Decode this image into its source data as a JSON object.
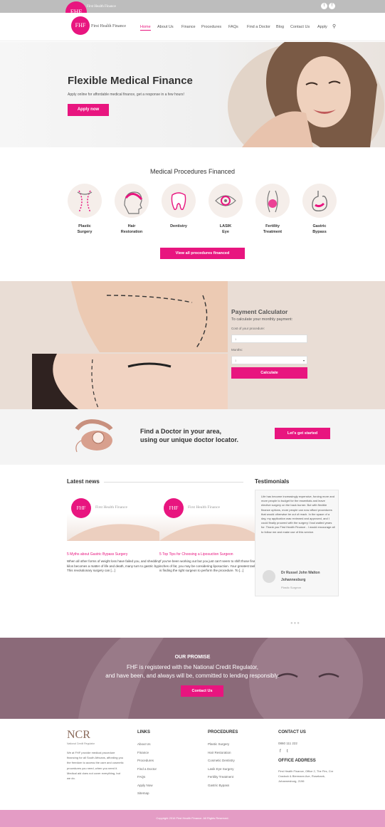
{
  "brand": {
    "logo": "FHF",
    "name": "First Health Finance",
    "accent": "#e8157f"
  },
  "topbar": {
    "logo_text": "First Health Finance",
    "social": [
      "twitter-icon",
      "facebook-icon"
    ]
  },
  "nav": {
    "items": [
      "Home",
      "About Us",
      "Finance",
      "Procedures",
      "FAQs",
      "Find a Doctor",
      "Blog",
      "Contact Us",
      "Apply"
    ]
  },
  "hero": {
    "title": "Flexible Medical Finance",
    "subtitle": "Apply online for affordable medical finance, get a response in a few hours!",
    "button": "Apply now"
  },
  "procedures": {
    "title": "Medical Procedures Financed",
    "items": [
      {
        "line1": "Plastic",
        "line2": "Surgery",
        "icon": "plastic-surgery-icon"
      },
      {
        "line1": "Hair",
        "line2": "Restoration",
        "icon": "hair-restoration-icon"
      },
      {
        "line1": "Dentistry",
        "line2": "",
        "icon": "tooth-icon"
      },
      {
        "line1": "LASIK",
        "line2": "Eye",
        "icon": "eye-icon"
      },
      {
        "line1": "Fertility",
        "line2": "Treatment",
        "icon": "fertility-icon"
      },
      {
        "line1": "Gastric",
        "line2": "Bypass",
        "icon": "stomach-icon"
      }
    ],
    "button": "View all procedures financed"
  },
  "calculator": {
    "title": "Payment Calculator",
    "subtitle": "To calculate your monthly payment:",
    "cost_label": "Cost of your procedure:",
    "cost_value": "1",
    "months_label": "Months:",
    "months_value": "1",
    "button": "Calculate"
  },
  "doctor": {
    "line1": "Find a Doctor in your area,",
    "line2": "using our unique doctor locator.",
    "button": "Let's get started"
  },
  "news": {
    "title": "Latest news",
    "cards": [
      {
        "logo": "FHF",
        "brand": "First Health Finance",
        "title": "5 Myths about Gastric Bypass Surgery",
        "body": "When all other forms of weight loss have failed you, and shedding the kilos becomes a matter of life and death, many turn to gastric bypass. This revolutionary surgery can [...]"
      },
      {
        "logo": "FHF",
        "brand": "First Health Finance",
        "title": "5 Top Tips for Choosing a Liposuction Surgeon",
        "body": "If you've been working out but you just can't seem to shift those final few inches of fat, you may be considering liposuction. Your greatest task now is finding the right surgeon to perform the procedure. To [...]"
      }
    ]
  },
  "testimonials": {
    "title": "Testimonials",
    "quote": "Life has become increasingly expensive, forcing more and more people to budget for the essentials and leave elective surgery on the back burner. But with flexible finance options, more people can now afford procedures that would otherwise be out of reach. In the space of a day, my application was reviewed and approved, and I could finally proceed with the surgery I had waited years for. Thank you First Health Finance - I would encourage all to follow me and make use of this service.",
    "author": "Dr Russel John Walton",
    "location": "Johannesburg",
    "role": "Plastic Surgeon"
  },
  "promise": {
    "title": "OUR PROMISE",
    "line1": "FHF is registered with the National Credit Regulator,",
    "line2": "and have been, and always will be, committed to lending responsibly.",
    "button": "Contact Us"
  },
  "footer": {
    "ncr_logo": "NCR",
    "ncr_sub": "National Credit Regulator",
    "about": "We at FHF provide medical procedure financing for all South Africans, affording you the freedom to access the care and cosmetic procedures you need, when you need it. Medical aid does not cover everything, but we do.",
    "links_title": "LINKS",
    "links": [
      "About Us",
      "Finance",
      "Procedures",
      "Find a Doctor",
      "FAQs",
      "Apply Now",
      "Sitemap"
    ],
    "proc_title": "PROCEDURES",
    "procs": [
      "Plastic Surgery",
      "Hair Restoration",
      "Cosmetic Dentistry",
      "Lasik Eye Surgery",
      "Fertility Treatment",
      "Gastric Bypass"
    ],
    "contact_title": "CONTACT US",
    "phone": "0860 111 222",
    "office_title": "OFFICE ADDRESS",
    "address": "First Health Finance, Office 2, The Firs, Cnr Cradock & Biermann Ave, Rosebank, Johannesburg, 2196",
    "copyright": "Copyright 2016 First Health Finance. All Rights Reserved."
  }
}
